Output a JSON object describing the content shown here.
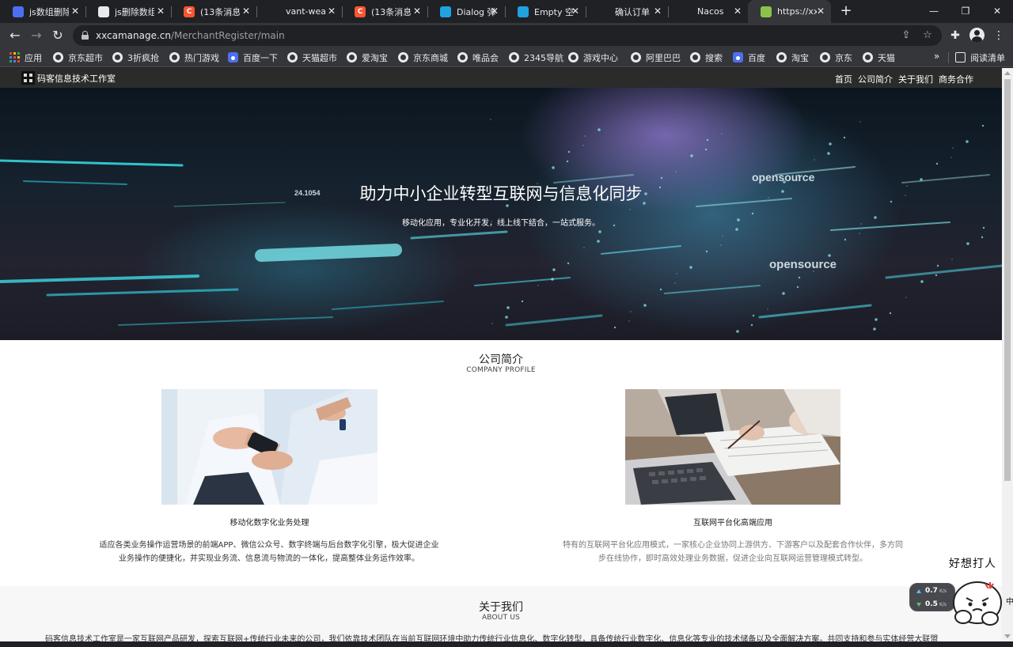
{
  "browser": {
    "tabs": [
      {
        "title": "js数组删除",
        "favicon_color": "#4e6ef2",
        "favicon_glyph": "",
        "active": false
      },
      {
        "title": "js删除数组",
        "favicon_color": "#e8eaed",
        "favicon_glyph": "",
        "active": false
      },
      {
        "title": "(13条消息",
        "favicon_color": "#fc5531",
        "favicon_glyph": "C",
        "active": false
      },
      {
        "title": "vant-weap",
        "favicon_color": "#202124",
        "favicon_glyph": "",
        "active": false
      },
      {
        "title": "(13条消息",
        "favicon_color": "#fc5531",
        "favicon_glyph": "C",
        "active": false
      },
      {
        "title": "Dialog 弹出",
        "favicon_color": "#1fa3e0",
        "favicon_glyph": "",
        "active": false
      },
      {
        "title": "Empty 空状",
        "favicon_color": "#1fa3e0",
        "favicon_glyph": "",
        "active": false
      },
      {
        "title": "确认订单",
        "favicon_color": "#202124",
        "favicon_glyph": "",
        "active": false
      },
      {
        "title": "Nacos",
        "favicon_color": "#202124",
        "favicon_glyph": "",
        "active": false
      },
      {
        "title": "https://xx",
        "favicon_color": "#8bc34a",
        "favicon_glyph": "",
        "active": true
      }
    ],
    "url_host": "xxcamanage.cn",
    "url_path": "/MerchantRegister/main",
    "bookmarks": [
      {
        "label": "应用",
        "icon": "apps-grid-icon"
      },
      {
        "label": "京东超市",
        "icon": "globe-icon"
      },
      {
        "label": "3折疯抢",
        "icon": "globe-icon"
      },
      {
        "label": "热门游戏",
        "icon": "globe-icon"
      },
      {
        "label": "百度一下",
        "icon": "baidu-paw-icon"
      },
      {
        "label": "天猫超市",
        "icon": "globe-icon"
      },
      {
        "label": "爱淘宝",
        "icon": "globe-icon"
      },
      {
        "label": "京东商城",
        "icon": "globe-icon"
      },
      {
        "label": "唯品会",
        "icon": "globe-icon"
      },
      {
        "label": "2345导航",
        "icon": "globe-icon"
      },
      {
        "label": "游戏中心",
        "icon": "globe-icon"
      },
      {
        "label": "阿里巴巴",
        "icon": "globe-icon"
      },
      {
        "label": "搜索",
        "icon": "globe-icon"
      },
      {
        "label": "百度",
        "icon": "baidu-paw-icon"
      },
      {
        "label": "淘宝",
        "icon": "globe-icon"
      },
      {
        "label": "京东",
        "icon": "globe-icon"
      },
      {
        "label": "天猫",
        "icon": "globe-icon"
      }
    ],
    "bookmarks_more": "»",
    "reading_list": "阅读清单"
  },
  "site": {
    "brand": "码客信息技术工作室",
    "nav": [
      "首页",
      "公司简介",
      "关于我们",
      "商务合作"
    ],
    "hero": {
      "title": "助力中小企业转型互联网与信息化同步",
      "subtitle": "移动化应用，专业化开发，线上线下结合，一站式服务。",
      "art_text": [
        "opensource",
        "opensource",
        "24.1054"
      ]
    },
    "profile": {
      "title": "公司简介",
      "subtitle": "COMPANY PROFILE",
      "cards": [
        {
          "title": "移动化数字化业务处理",
          "desc_lines": [
            "适应各类业务操作运营场景的前端APP、微信公众号、数字终端与后台数字化引擎，极大促进企业",
            "业务操作的便捷化，并实现业务流、信息流与物流的一体化，提高整体业务运作效率。"
          ],
          "desc_color": "#333333"
        },
        {
          "title": "互联网平台化高端应用",
          "desc_lines": [
            "特有的互联网平台化应用模式，一家核心企业协同上游供方、下游客户以及配套合作伙伴，多方同",
            "步在线协作，即时高效处理业务数据，促进企业向互联网运营管理模式转型。"
          ],
          "desc_color": "#777777"
        }
      ]
    },
    "about": {
      "title": "关于我们",
      "subtitle": "ABOUT US",
      "text": "码客信息技术工作室是一家互联网产品研发，探索互联网+传统行业未来的公司，我们依靠技术团队在当前互联网环境中助力传统行业信息化、数字化转型，具备传统行业数字化、信息化等专业的技术储备以及全面解决方案。共同支持和参与实体经营大联盟"
    }
  },
  "overlay": {
    "upload_speed": "0.7",
    "download_speed": "0.5",
    "speed_unit": "K/s",
    "sticker_caption": "好想打人",
    "side_char": "中"
  }
}
